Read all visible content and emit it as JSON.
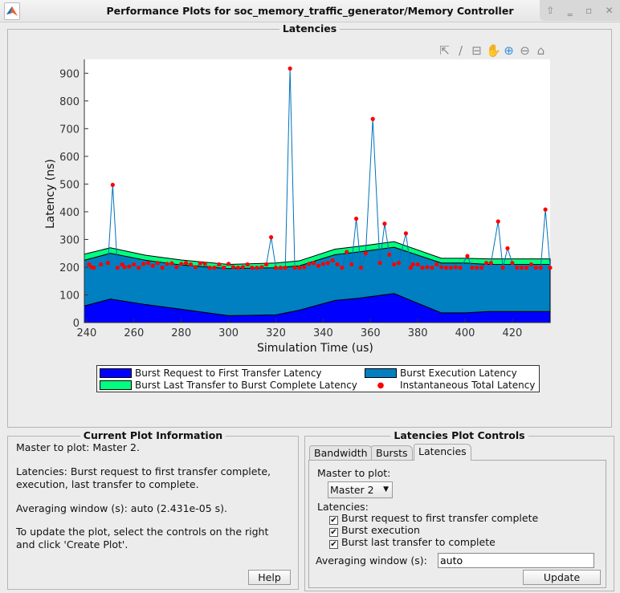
{
  "window": {
    "title": "Performance Plots for soc_memory_traffic_generator/Memory Controller",
    "controls": [
      "up-icon",
      "minimize-icon",
      "maximize-icon",
      "close-icon"
    ]
  },
  "plot_panel": {
    "title": "Latencies"
  },
  "toolbar": [
    "export-icon",
    "brush-icon",
    "datatip-icon",
    "pan-icon",
    "zoom-in-icon",
    "zoom-out-icon",
    "home-icon"
  ],
  "chart_data": {
    "type": "area",
    "title": "",
    "xlabel": "Simulation Time (us)",
    "ylabel": "Latency (ns)",
    "xlim": [
      239,
      436
    ],
    "ylim": [
      0,
      950
    ],
    "xticks": [
      240,
      260,
      280,
      300,
      320,
      340,
      360,
      380,
      400,
      420
    ],
    "yticks": [
      0,
      100,
      200,
      300,
      400,
      500,
      600,
      700,
      800,
      900
    ],
    "area_x": [
      239,
      250,
      265,
      280,
      300,
      320,
      330,
      345,
      355,
      370,
      390,
      400,
      410,
      436
    ],
    "series": [
      {
        "name": "Burst Request to First Transfer Latency",
        "color": "#0000ff",
        "values": [
          60,
          85,
          65,
          48,
          25,
          28,
          45,
          80,
          88,
          105,
          35,
          35,
          40,
          40
        ]
      },
      {
        "name": "Burst Execution Latency",
        "color": "#0080c0",
        "values": [
          165,
          165,
          160,
          160,
          170,
          170,
          160,
          165,
          167,
          167,
          180,
          180,
          170,
          170
        ]
      },
      {
        "name": "Burst Last Transfer to Burst Complete Latency",
        "color": "#00ff80",
        "values": [
          22,
          20,
          18,
          18,
          15,
          17,
          18,
          20,
          20,
          20,
          17,
          17,
          20,
          20
        ]
      }
    ],
    "points": {
      "name": "Instantaneous Total Latency",
      "color": "#ff0000",
      "line_color": "#0072bd",
      "xy": [
        [
          241,
          210
        ],
        [
          242,
          200
        ],
        [
          243,
          198
        ],
        [
          246,
          210
        ],
        [
          249,
          215
        ],
        [
          251,
          497
        ],
        [
          253,
          198
        ],
        [
          255,
          210
        ],
        [
          256,
          200
        ],
        [
          258,
          202
        ],
        [
          260,
          210
        ],
        [
          262,
          198
        ],
        [
          264,
          212
        ],
        [
          266,
          215
        ],
        [
          268,
          205
        ],
        [
          270,
          215
        ],
        [
          272,
          198
        ],
        [
          274,
          212
        ],
        [
          276,
          214
        ],
        [
          278,
          200
        ],
        [
          280,
          212
        ],
        [
          282,
          215
        ],
        [
          284,
          210
        ],
        [
          286,
          200
        ],
        [
          288,
          214
        ],
        [
          290,
          212
        ],
        [
          292,
          198
        ],
        [
          294,
          198
        ],
        [
          296,
          210
        ],
        [
          298,
          198
        ],
        [
          300,
          212
        ],
        [
          302,
          200
        ],
        [
          304,
          198
        ],
        [
          306,
          200
        ],
        [
          308,
          210
        ],
        [
          310,
          198
        ],
        [
          312,
          198
        ],
        [
          314,
          200
        ],
        [
          316,
          210
        ],
        [
          318,
          308
        ],
        [
          320,
          198
        ],
        [
          322,
          198
        ],
        [
          324,
          198
        ],
        [
          326,
          917
        ],
        [
          328,
          198
        ],
        [
          330,
          198
        ],
        [
          332,
          200
        ],
        [
          334,
          212
        ],
        [
          336,
          215
        ],
        [
          338,
          205
        ],
        [
          340,
          212
        ],
        [
          342,
          215
        ],
        [
          344,
          225
        ],
        [
          346,
          210
        ],
        [
          348,
          198
        ],
        [
          350,
          255
        ],
        [
          352,
          210
        ],
        [
          354,
          375
        ],
        [
          356,
          198
        ],
        [
          358,
          250
        ],
        [
          361,
          735
        ],
        [
          364,
          215
        ],
        [
          366,
          357
        ],
        [
          368,
          245
        ],
        [
          370,
          210
        ],
        [
          372,
          215
        ],
        [
          375,
          322
        ],
        [
          377,
          198
        ],
        [
          378,
          210
        ],
        [
          380,
          210
        ],
        [
          382,
          198
        ],
        [
          384,
          200
        ],
        [
          386,
          198
        ],
        [
          388,
          210
        ],
        [
          390,
          200
        ],
        [
          392,
          198
        ],
        [
          394,
          198
        ],
        [
          396,
          200
        ],
        [
          398,
          198
        ],
        [
          401,
          240
        ],
        [
          403,
          198
        ],
        [
          405,
          198
        ],
        [
          407,
          198
        ],
        [
          409,
          215
        ],
        [
          411,
          215
        ],
        [
          414,
          365
        ],
        [
          416,
          198
        ],
        [
          418,
          268
        ],
        [
          420,
          215
        ],
        [
          422,
          198
        ],
        [
          424,
          198
        ],
        [
          426,
          198
        ],
        [
          428,
          210
        ],
        [
          430,
          198
        ],
        [
          432,
          198
        ],
        [
          434,
          408
        ],
        [
          436,
          198
        ]
      ]
    },
    "legend": {
      "placement": "bottom",
      "entries": [
        "Burst Request to First Transfer Latency",
        "Burst Execution Latency",
        "Burst Last Transfer to Burst Complete Latency",
        "Instantaneous Total Latency"
      ]
    }
  },
  "info": {
    "title": "Current Plot Information",
    "lines": [
      "Master to plot: Master 2.",
      "Latencies: Burst request to first transfer complete,",
      "execution, last transfer to complete.",
      "Averaging window (s): auto (2.431e-05 s).",
      "To update the plot, select the controls on the right",
      "and click 'Create Plot'."
    ],
    "help": "Help"
  },
  "controls": {
    "title": "Latencies Plot Controls",
    "tabs": [
      "Bandwidth",
      "Bursts",
      "Latencies"
    ],
    "master_label": "Master to plot:",
    "master_value": "Master 2",
    "latencies_label": "Latencies:",
    "checks": [
      "Burst request to first transfer complete",
      "Burst execution",
      "Burst last transfer to complete"
    ],
    "avg_label": "Averaging window (s):",
    "avg_value": "auto",
    "update": "Update"
  }
}
